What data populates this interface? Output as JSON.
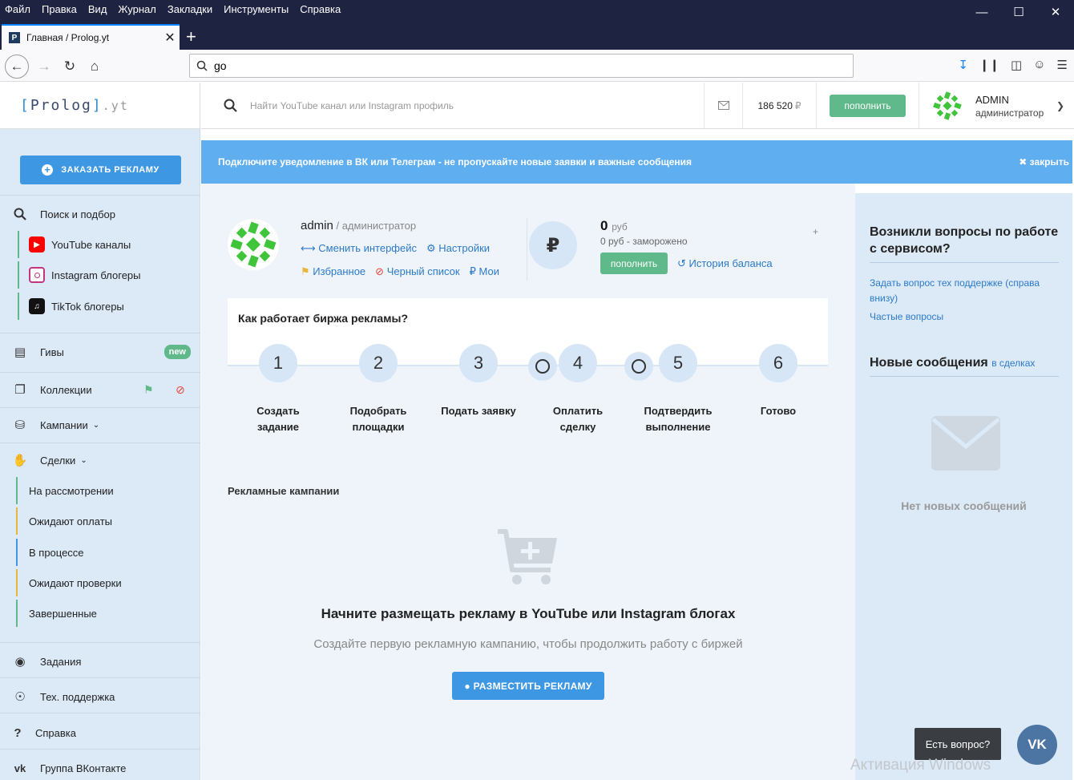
{
  "browser": {
    "menu": [
      "Файл",
      "Правка",
      "Вид",
      "Журнал",
      "Закладки",
      "Инструменты",
      "Справка"
    ],
    "tab_title": "Главная / Prolog.yt",
    "favicon_letter": "P",
    "url": "go"
  },
  "header": {
    "logo_open": "[",
    "logo_text": "Prolog",
    "logo_close": "]",
    "logo_ext": ".yt",
    "search_placeholder": "Найти YouTube канал или Instagram профиль",
    "balance": "186 520",
    "currency": "₽",
    "topup_label": "пополнить",
    "user_name": "ADMIN",
    "user_role": "администратор"
  },
  "sidebar": {
    "order_button": "ЗАКАЗАТЬ РЕКЛАМУ",
    "search_label": "Поиск и подбор",
    "search_subitems": [
      {
        "label": "YouTube каналы",
        "color": "#ff0000"
      },
      {
        "label": "Instagram блогеры",
        "color": "#c13584"
      },
      {
        "label": "TikTok блогеры",
        "color": "#111111"
      }
    ],
    "gives": "Гивы",
    "gives_badge": "new",
    "collections": "Коллекции",
    "campaigns": "Кампании",
    "deals": "Сделки",
    "deal_items": [
      {
        "label": "На рассмотрении",
        "color": "#5fb98a"
      },
      {
        "label": "Ожидают оплаты",
        "color": "#e7b73c"
      },
      {
        "label": "В процессе",
        "color": "#3d97e3"
      },
      {
        "label": "Ожидают проверки",
        "color": "#e7b73c"
      },
      {
        "label": "Завершенные",
        "color": "#5fb98a"
      }
    ],
    "tasks": "Задания",
    "support": "Тех. поддержка",
    "help": "Справка",
    "vk_group": "Группа ВКонтакте"
  },
  "notice": {
    "text": "Подключите уведомление в ВК или Телеграм - не пропускайте новые заявки и важные сообщения",
    "close": "закрыть"
  },
  "profile": {
    "name": "admin",
    "role": " / администратор",
    "links1": [
      "Сменить интерфейс",
      "Настройки"
    ],
    "links2": [
      "Избранное",
      "Черный список",
      "Мои"
    ],
    "balance": "0",
    "balance_unit": "руб",
    "frozen": "0 руб - заморожено",
    "topup": "пополнить",
    "history": "История баланса",
    "plus": "+"
  },
  "how": {
    "title": "Как работает биржа рекламы?",
    "steps": [
      {
        "num": "1",
        "label": "Создать задание"
      },
      {
        "num": "2",
        "label": "Подобрать площадки"
      },
      {
        "num": "3",
        "label": "Подать заявку"
      },
      {
        "num": "4",
        "label": "Оплатить сделку"
      },
      {
        "num": "5",
        "label": "Подтвердить выполнение"
      },
      {
        "num": "6",
        "label": "Готово"
      }
    ]
  },
  "campaigns": {
    "title": "Рекламные кампании",
    "empty_title": "Начните размещать рекламу в YouTube или Instagram блогах",
    "empty_sub": "Создайте первую рекламную кампанию, чтобы продолжить работу с биржей",
    "button": "РАЗМЕСТИТЬ РЕКЛАМУ"
  },
  "right": {
    "q_title": "Возникли вопросы по работе с сервисом?",
    "q_link1": "Задать вопрос тех поддержке (справа внизу)",
    "q_link2": "Частые вопросы",
    "msg_title": "Новые сообщения",
    "msg_small": "в сделках",
    "msg_empty": "Нет новых сообщений"
  },
  "chat": {
    "tip": "Есть вопрос?",
    "vk": "VK"
  },
  "watermark": "Активация Windows"
}
